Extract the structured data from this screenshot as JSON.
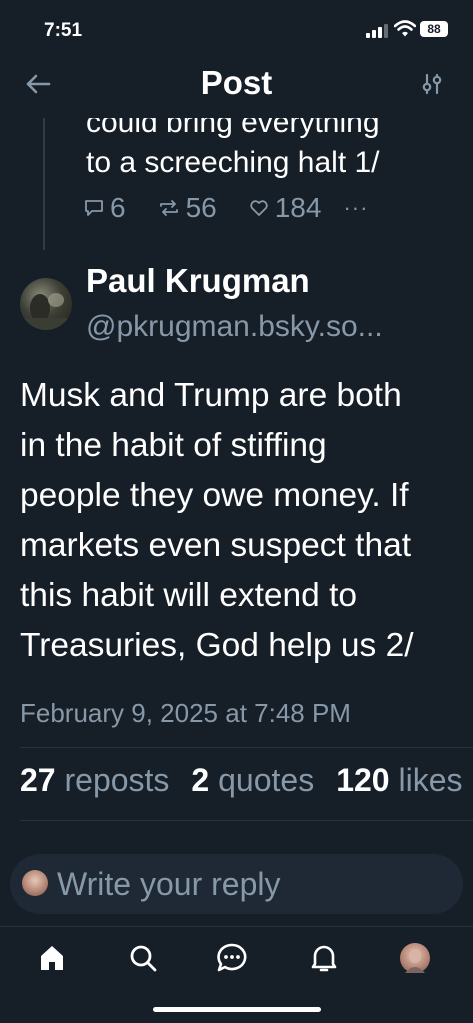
{
  "status_bar": {
    "time": "7:51",
    "battery": "88"
  },
  "header": {
    "title": "Post",
    "back_icon": "arrow-left-icon",
    "filter_icon": "sliders-icon"
  },
  "parent_post": {
    "text_line1": "could bring everything",
    "text_line2": "to a screeching halt 1/",
    "replies": "6",
    "reposts": "56",
    "likes": "184",
    "more": "···"
  },
  "post": {
    "author_name": "Paul Krugman",
    "author_handle": "@pkrugman.bsky.so...",
    "lines": [
      "Musk and Trump are both",
      "in the habit of stiffing",
      "people they owe money. If",
      "markets even suspect that",
      "this habit will extend to",
      "Treasuries, God help us 2/"
    ],
    "timestamp": "February 9, 2025 at 7:48 PM",
    "reposts_count": "27",
    "reposts_label": "reposts",
    "quotes_count": "2",
    "quotes_label": "quotes",
    "likes_count": "120",
    "likes_label": "likes"
  },
  "reply": {
    "placeholder": "Write your reply"
  },
  "tabbar": {
    "items": [
      "home-icon",
      "search-icon",
      "chat-icon",
      "bell-icon",
      "profile-avatar"
    ],
    "accent": "#ffffff"
  },
  "colors": {
    "background": "#161e27",
    "muted": "#8798a9",
    "input_bg": "#1e2935"
  }
}
